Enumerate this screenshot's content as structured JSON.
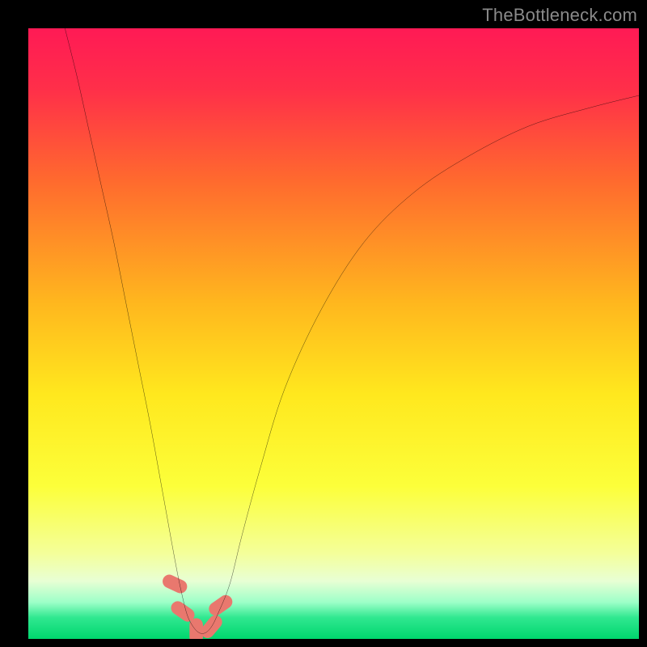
{
  "watermark": "TheBottleneck.com",
  "chart_data": {
    "type": "line",
    "title": "",
    "xlabel": "",
    "ylabel": "",
    "xlim": [
      0,
      100
    ],
    "ylim": [
      0,
      100
    ],
    "grid": false,
    "legend": false,
    "gradient_stops": [
      {
        "pos": 0.0,
        "color": "#ff1a55"
      },
      {
        "pos": 0.1,
        "color": "#ff2f49"
      },
      {
        "pos": 0.25,
        "color": "#ff6a2e"
      },
      {
        "pos": 0.45,
        "color": "#ffb71e"
      },
      {
        "pos": 0.6,
        "color": "#ffe81e"
      },
      {
        "pos": 0.75,
        "color": "#fcff3a"
      },
      {
        "pos": 0.86,
        "color": "#f4ff9a"
      },
      {
        "pos": 0.905,
        "color": "#e8ffd4"
      },
      {
        "pos": 0.94,
        "color": "#9dffc8"
      },
      {
        "pos": 0.965,
        "color": "#30e890"
      },
      {
        "pos": 1.0,
        "color": "#00d66e"
      }
    ],
    "series": [
      {
        "name": "bottleneck-curve",
        "color": "#000000",
        "x": [
          6,
          8,
          10,
          12,
          14,
          16,
          18,
          20,
          22,
          24,
          25,
          26,
          27,
          28,
          29,
          30,
          31,
          33,
          35,
          38,
          42,
          48,
          55,
          63,
          72,
          82,
          92,
          100
        ],
        "values": [
          100,
          92,
          83,
          74,
          65,
          55,
          45,
          35,
          24,
          13,
          8,
          4,
          2,
          1,
          1,
          2,
          4,
          9,
          17,
          28,
          41,
          54,
          65,
          73,
          79,
          84,
          87,
          89
        ]
      }
    ],
    "markers": {
      "name": "bottleneck-markers",
      "color": "#e9786e",
      "points": [
        {
          "x": 24.0,
          "y": 9.0,
          "rot": -65
        },
        {
          "x": 25.3,
          "y": 4.5,
          "rot": -55
        },
        {
          "x": 27.5,
          "y": 1.3,
          "rot": 0
        },
        {
          "x": 30.0,
          "y": 2.0,
          "rot": 40
        },
        {
          "x": 31.5,
          "y": 5.5,
          "rot": 55
        }
      ]
    }
  }
}
